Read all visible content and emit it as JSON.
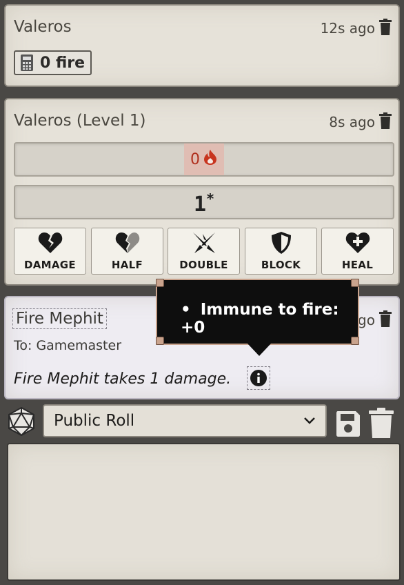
{
  "messages": [
    {
      "sender": "Valeros",
      "timestamp": "12s ago",
      "tag": {
        "icon": "calculator-icon",
        "text": "0 fire"
      }
    },
    {
      "sender": "Valeros (Level 1)",
      "timestamp": "8s ago",
      "damage": {
        "value": "0",
        "type_icon": "fire-icon"
      },
      "total": "1",
      "total_marker": "*",
      "buttons": [
        {
          "label": "DAMAGE",
          "icon": "broken-heart-icon"
        },
        {
          "label": "HALF",
          "icon": "half-heart-icon"
        },
        {
          "label": "DOUBLE",
          "icon": "double-slash-icon"
        },
        {
          "label": "BLOCK",
          "icon": "shield-icon"
        },
        {
          "label": "HEAL",
          "icon": "heal-heart-icon"
        }
      ]
    },
    {
      "sender": "Fire Mephit",
      "timestamp": "5s ago",
      "to": "To: Gamemaster",
      "text": "Fire Mephit takes 1 damage."
    }
  ],
  "tooltip": {
    "items": [
      "Immune to fire: +0"
    ]
  },
  "roll_mode": {
    "selected": "Public Roll"
  },
  "colors": {
    "fire": "#b0301e",
    "tooltip_bg": "#0e0e0e",
    "tooltip_border": "#c9a38d"
  }
}
